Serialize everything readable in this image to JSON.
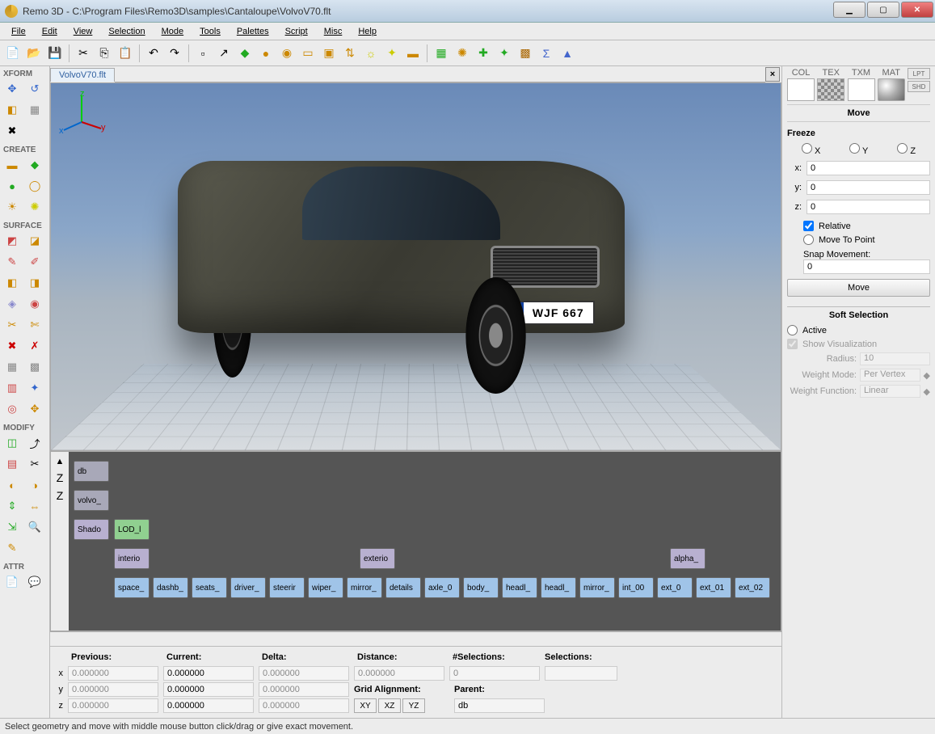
{
  "title": "Remo 3D - C:\\Program Files\\Remo3D\\samples\\Cantaloupe\\VolvoV70.flt",
  "menu": [
    "File",
    "Edit",
    "View",
    "Selection",
    "Mode",
    "Tools",
    "Palettes",
    "Script",
    "Misc",
    "Help"
  ],
  "viewport_tab": "VolvoV70.flt",
  "license_plate": "WJF 667",
  "left_sections": {
    "xform": "XFORM",
    "create": "CREATE",
    "surface": "SURFACE",
    "modify": "MODIFY",
    "attr": "ATTR"
  },
  "hierarchy": {
    "root": "db",
    "l1": "volvo_",
    "l2": [
      "Shado",
      "LOD_l"
    ],
    "l3": [
      "interio",
      "exterio",
      "alpha_"
    ],
    "l4": [
      "space_",
      "dashb_",
      "seats_",
      "driver_",
      "steerir",
      "wiper_",
      "mirror_",
      "details",
      "axle_0",
      "body_",
      "headl_",
      "headl_",
      "mirror_",
      "int_00",
      "ext_0",
      "ext_01",
      "ext_02"
    ]
  },
  "coords": {
    "previous_label": "Previous:",
    "current_label": "Current:",
    "delta_label": "Delta:",
    "distance_label": "Distance:",
    "nsel_label": "#Selections:",
    "selections_label": "Selections:",
    "gridalign_label": "Grid Alignment:",
    "parent_label": "Parent:",
    "zero": "0.000000",
    "nsel_val": "0",
    "parent_val": "db",
    "grid_btns": [
      "XY",
      "XZ",
      "YZ"
    ]
  },
  "right": {
    "swatch_labels": [
      "COL",
      "TEX",
      "TXM",
      "MAT"
    ],
    "mini_btns": [
      "LPT",
      "SHD"
    ],
    "move_title": "Move",
    "freeze": "Freeze",
    "axes": [
      "X",
      "Y",
      "Z"
    ],
    "x_val": "0",
    "y_val": "0",
    "z_val": "0",
    "relative": "Relative",
    "move_to_point": "Move To Point",
    "snap_label": "Snap Movement:",
    "snap_val": "0",
    "move_btn": "Move",
    "soft_title": "Soft Selection",
    "active": "Active",
    "show_viz": "Show Visualization",
    "radius": "Radius:",
    "radius_val": "10",
    "wmode": "Weight Mode:",
    "wmode_val": "Per Vertex",
    "wfunc": "Weight Function:",
    "wfunc_val": "Linear"
  },
  "status": "Select geometry and move with middle mouse button click/drag or give exact movement."
}
